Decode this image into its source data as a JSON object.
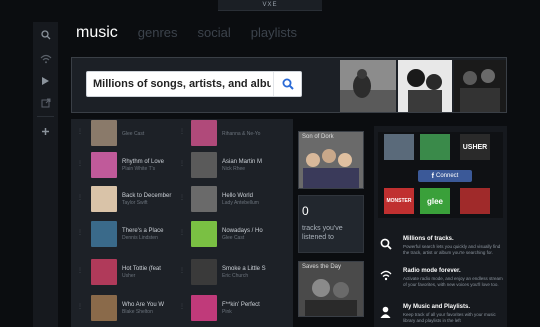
{
  "logo": {
    "text": "VXE"
  },
  "nav": {
    "tabs": [
      {
        "label": "music"
      },
      {
        "label": "genres"
      },
      {
        "label": "social"
      },
      {
        "label": "playlists"
      }
    ]
  },
  "search": {
    "value": "Millions of songs, artists, and albur"
  },
  "songs": [
    [
      {
        "title": "",
        "artist": "Glee Cast",
        "color": "#8a7a6a"
      },
      {
        "title": "",
        "artist": "Rihanna & Ne-Yo",
        "color": "#b04a7a"
      }
    ],
    [
      {
        "title": "Rhythm of Love",
        "artist": "Plain White T's",
        "color": "#c05a9a"
      },
      {
        "title": "Asian Martin M",
        "artist": "Nick Rhee",
        "color": "#5a5a5a"
      }
    ],
    [
      {
        "title": "Back to December",
        "artist": "Taylor Swift",
        "color": "#d9c3a8"
      },
      {
        "title": "Hello World",
        "artist": "Lady Antebellum",
        "color": "#6a6a6a"
      }
    ],
    [
      {
        "title": "There's a Place",
        "artist": "Dennis Lindsten",
        "color": "#3a6a8a"
      },
      {
        "title": "Nowadays / Ho",
        "artist": "Glee Cast",
        "color": "#7ac043"
      }
    ],
    [
      {
        "title": "Hot Tottie (feat",
        "artist": "Usher",
        "color": "#b03a5a"
      },
      {
        "title": "Smoke a Little S",
        "artist": "Eric Church",
        "color": "#3a3a3a"
      }
    ],
    [
      {
        "title": "Who Are You W",
        "artist": "Blake Shelton",
        "color": "#8a6a4a"
      },
      {
        "title": "F**kin' Perfect",
        "artist": "Pink",
        "color": "#c03a7a"
      }
    ]
  ],
  "mid": {
    "album_caption": "Son of Dork",
    "counter": {
      "value": "0",
      "label": "tracks you've listened to"
    },
    "album2_caption": "Saves the Day"
  },
  "social": {
    "connect_label": "Connect",
    "fb_glyph": "f",
    "tiles": [
      "USHER",
      "MONSTER",
      "glee"
    ]
  },
  "features": [
    {
      "icon": "search-icon",
      "title": "Millions of tracks.",
      "desc": "Powerful search lets you quickly and visually find the track, artist or album you're searching for."
    },
    {
      "icon": "radio-icon",
      "title": "Radio mode forever.",
      "desc": "Activate radio mode, and enjoy an endless stream of your favorites, with new voices you'll love too."
    },
    {
      "icon": "user-icon",
      "title": "My Music and Playlists.",
      "desc": "Keep track of all your favorites with your music library and playlists in the left"
    }
  ]
}
